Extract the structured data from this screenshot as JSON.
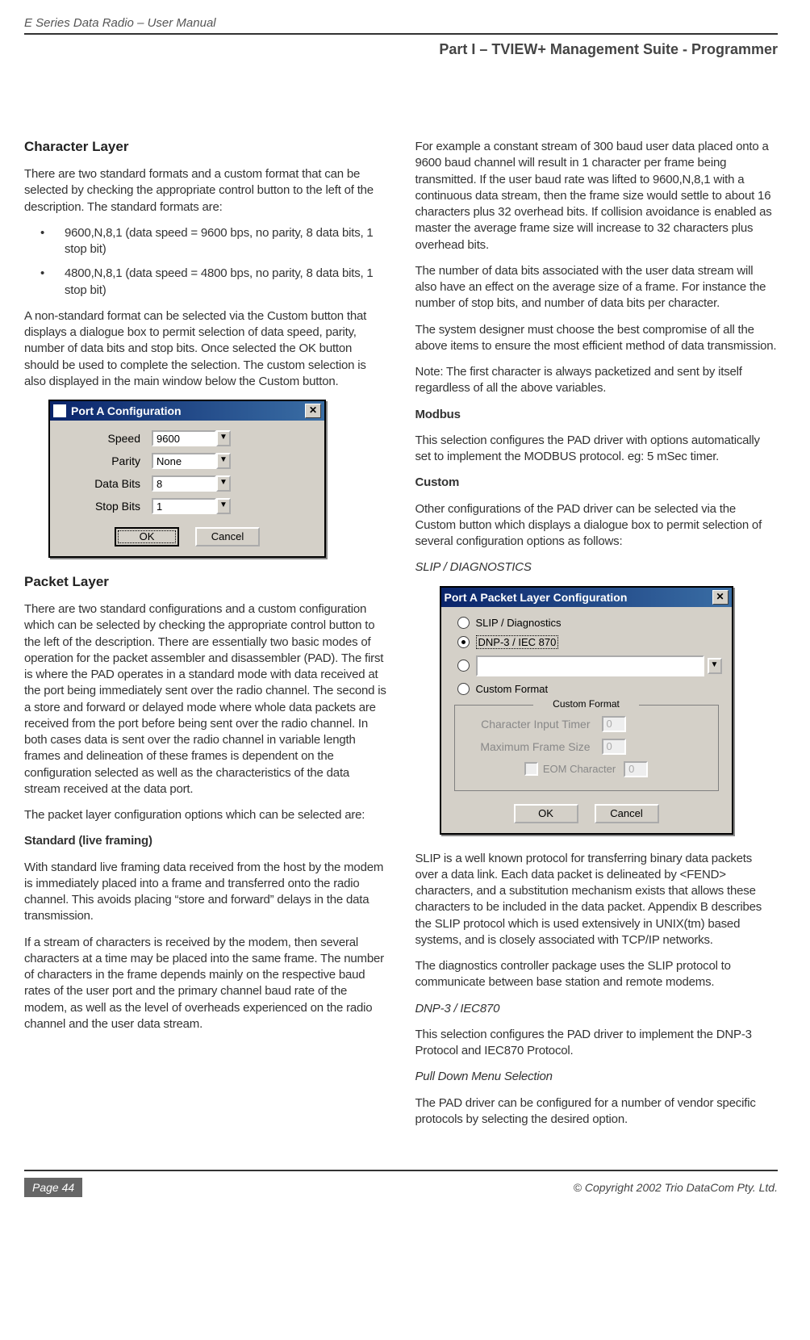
{
  "header": {
    "doc_title": "E Series Data Radio – User Manual",
    "part_title": "Part I – TVIEW+ Management Suite - Programmer"
  },
  "left": {
    "h_char_layer": "Character Layer",
    "p1": "There are two standard formats and a custom format that can be selected by checking the appropriate control button to the left of the description. The standard formats are:",
    "li1": "9600,N,8,1  (data speed = 9600 bps, no parity, 8 data bits, 1 stop bit)",
    "li2": "4800,N,8,1  (data speed = 4800 bps, no parity, 8 data bits, 1 stop bit)",
    "p2": "A non-standard format can be selected via the Custom button that displays a dialogue box to permit selection of data speed, parity, number of data bits and stop bits. Once selected the OK button should be used to complete the selection. The custom selection is also displayed in the main window below the Custom button.",
    "h_packet_layer": "Packet Layer",
    "p3": "There are two standard configurations and a custom configuration which can be selected by checking the appropriate control button to the left of the description. There are essentially two basic modes of operation for the packet assembler and disassembler (PAD). The first is where the PAD operates in a standard mode with data received at the port being immediately sent over the radio channel. The second is a store and forward or delayed mode where whole data packets are received from the port before being sent over the radio channel. In both cases data is sent over the radio channel in variable length frames and delineation of these frames is dependent on the configuration selected as well as the characteristics of the data stream received at the data port.",
    "p4": "The packet layer configuration options which can be selected are:",
    "sub_std": "Standard (live framing)",
    "p5": "With standard live framing data received from the host by the modem is immediately placed into a frame and transferred onto the radio channel.  This avoids placing “store and forward” delays in the data transmission.",
    "p6": "If a stream of characters is received by the modem, then several characters at a time may be placed into the same frame.  The number of characters in the frame depends mainly on the respective baud rates of the user port and the primary channel baud rate of the modem, as well as the level of overheads experienced on the radio channel and the user data stream."
  },
  "right": {
    "p1": "For example a constant stream of 300 baud user data placed onto a 9600 baud channel will result in 1 character per frame being transmitted.  If the user baud rate was lifted to 9600,N,8,1 with a continuous data stream, then the frame size would settle to about 16 characters plus 32 overhead bits.  If collision avoidance is enabled as master the average frame size will increase to 32 characters plus overhead bits.",
    "p2": "The number of data bits associated with the user data stream will also have an effect on the average size of a frame.  For instance the number of stop bits, and number of data bits per character.",
    "p3": "The system designer must choose the best compromise of all the above items to ensure the most efficient method of data transmission.",
    "p4": "Note: The first character is always packetized and sent by itself regardless of all the above variables.",
    "sub_modbus": "Modbus",
    "p5": "This selection configures the PAD driver with options automatically set to implement the MODBUS protocol. eg: 5 mSec timer.",
    "sub_custom": "Custom",
    "p6": "Other configurations of the PAD driver can be selected via the Custom button which displays a dialogue box to permit selection of several configuration options as follows:",
    "ital_slip": "SLIP / DIAGNOSTICS",
    "p7": "SLIP is a well known protocol for transferring binary data packets over a data link. Each data packet is delineated by <FEND> characters, and a substitution mechanism exists that allows these characters to be included in the data packet. Appendix B describes the SLIP protocol which is used extensively in UNIX(tm) based systems, and is closely associated with TCP/IP networks.",
    "p8": "The diagnostics controller package uses the SLIP protocol to communicate between base station and remote modems.",
    "ital_dnp": "DNP-3 / IEC870",
    "p9": "This selection configures the PAD driver to implement the DNP-3 Protocol and IEC870 Protocol.",
    "ital_pulldown": "Pull Down Menu Selection",
    "p10": "The PAD driver can be configured for a number of vendor specific protocols by selecting the desired option."
  },
  "dialog1": {
    "title": "Port A Configuration",
    "speed_label": "Speed",
    "speed_value": "9600",
    "parity_label": "Parity",
    "parity_value": "None",
    "databits_label": "Data Bits",
    "databits_value": "8",
    "stopbits_label": "Stop Bits",
    "stopbits_value": "1",
    "ok": "OK",
    "cancel": "Cancel"
  },
  "dialog2": {
    "title": "Port A Packet Layer Configuration",
    "opt1": "SLIP / Diagnostics",
    "opt2": "DNP-3 / IEC 870",
    "opt4": "Custom Format",
    "legend": "Custom Format",
    "char_timer": "Character Input Timer",
    "char_timer_val": "0",
    "max_frame": "Maximum Frame Size",
    "max_frame_val": "0",
    "eom": "EOM Character",
    "eom_val": "0",
    "ok": "OK",
    "cancel": "Cancel"
  },
  "footer": {
    "page": "Page 44",
    "copyright": "© Copyright 2002 Trio DataCom Pty. Ltd."
  }
}
